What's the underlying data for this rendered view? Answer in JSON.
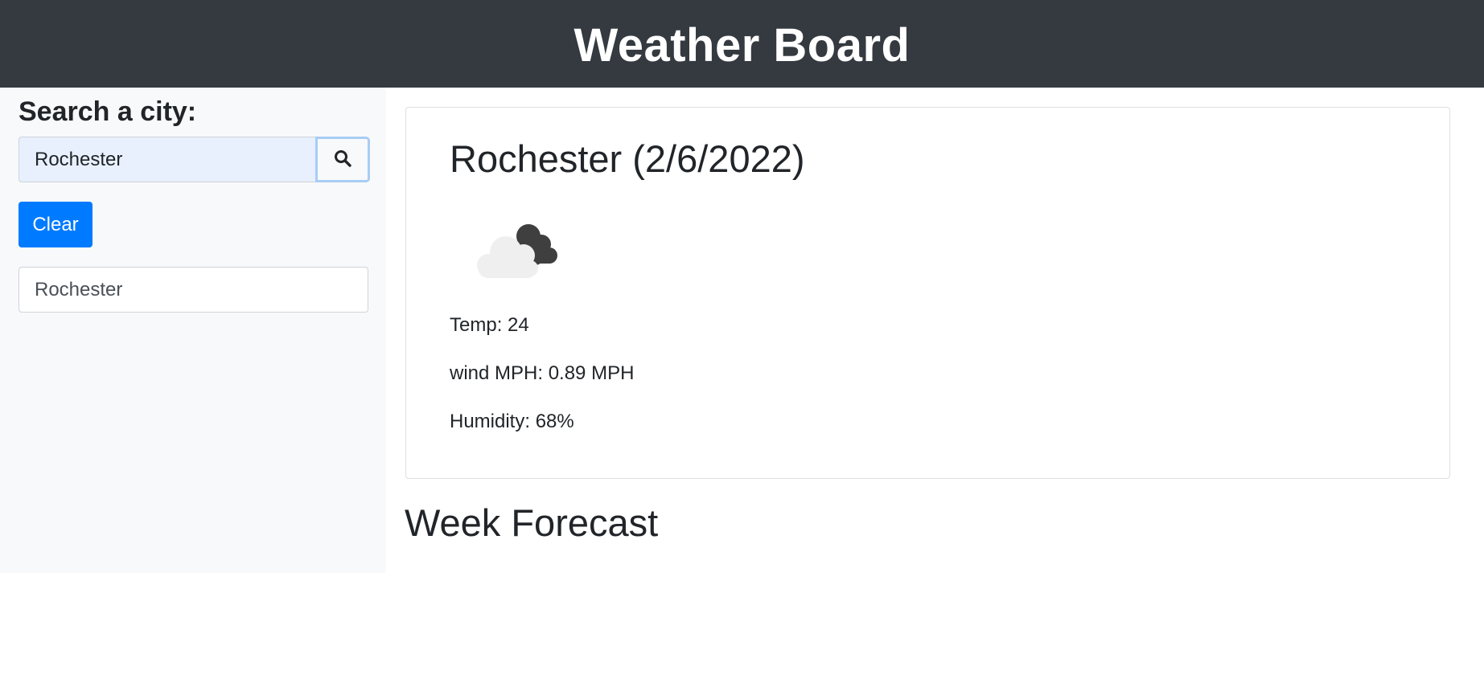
{
  "header": {
    "title": "Weather Board"
  },
  "sidebar": {
    "search_heading": "Search a city:",
    "search_input_value": "Rochester",
    "search_button_icon": "search-icon",
    "clear_label": "Clear",
    "history": [
      "Rochester"
    ]
  },
  "current": {
    "city_title": "Rochester (2/6/2022)",
    "icon": "cloudy-icon",
    "temp": "Temp: 24",
    "wind": "wind MPH: 0.89 MPH",
    "humidity": "Humidity: 68%"
  },
  "forecast": {
    "heading": "Week Forecast"
  },
  "colors": {
    "header_bg": "#343a40",
    "sidebar_bg": "#f8f9fa",
    "primary": "#007bff",
    "input_autofill_bg": "#e8f0fe"
  }
}
